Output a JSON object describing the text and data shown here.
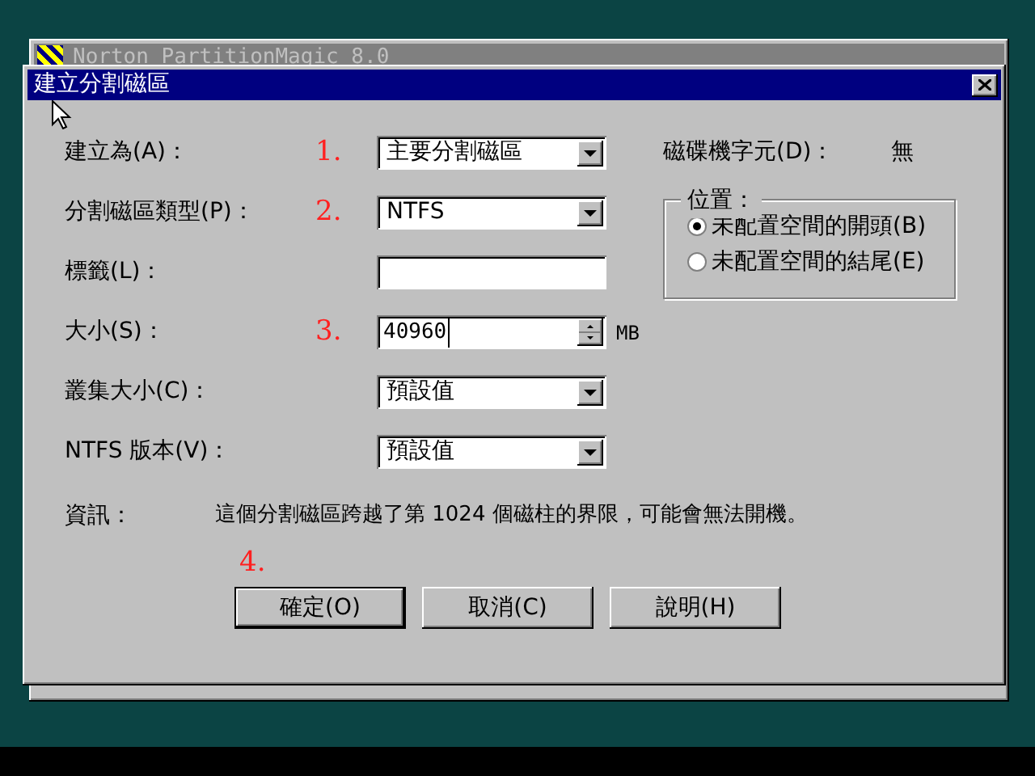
{
  "background_window": {
    "title": "Norton PartitionMagic 8.0"
  },
  "dialog": {
    "title": "建立分割磁區"
  },
  "fields": [
    {
      "kind": "dropdown",
      "label": "建立為(A)：",
      "step": "1.",
      "value": "主要分割磁區"
    },
    {
      "kind": "dropdown",
      "label": "分割磁區類型(P)：",
      "step": "2.",
      "value": "NTFS"
    },
    {
      "kind": "text",
      "label": "標籤(L)："
    },
    {
      "kind": "spin",
      "label": "大小(S)：",
      "step": "3.",
      "value": "40960",
      "unit": "MB"
    },
    {
      "kind": "dropdown",
      "label": "叢集大小(C)：",
      "value": "預設值"
    },
    {
      "kind": "dropdown",
      "label": "NTFS 版本(V)：",
      "value": "預設值"
    }
  ],
  "drive_letter": {
    "label": "磁碟機字元(D)：",
    "value": "無"
  },
  "position": {
    "title": "位置：",
    "options": [
      {
        "label": "未配置空間的開頭(B)",
        "selected": true
      },
      {
        "label": "未配置空間的結尾(E)",
        "selected": false
      }
    ]
  },
  "info": {
    "label": "資訊：",
    "text": "這個分割磁區跨越了第 1024 個磁柱的界限，可能會無法開機。"
  },
  "buttons_step": "4.",
  "buttons": [
    {
      "label": "確定(O)",
      "default": true
    },
    {
      "label": "取消(C)",
      "default": false
    },
    {
      "label": "說明(H)",
      "default": false
    }
  ]
}
